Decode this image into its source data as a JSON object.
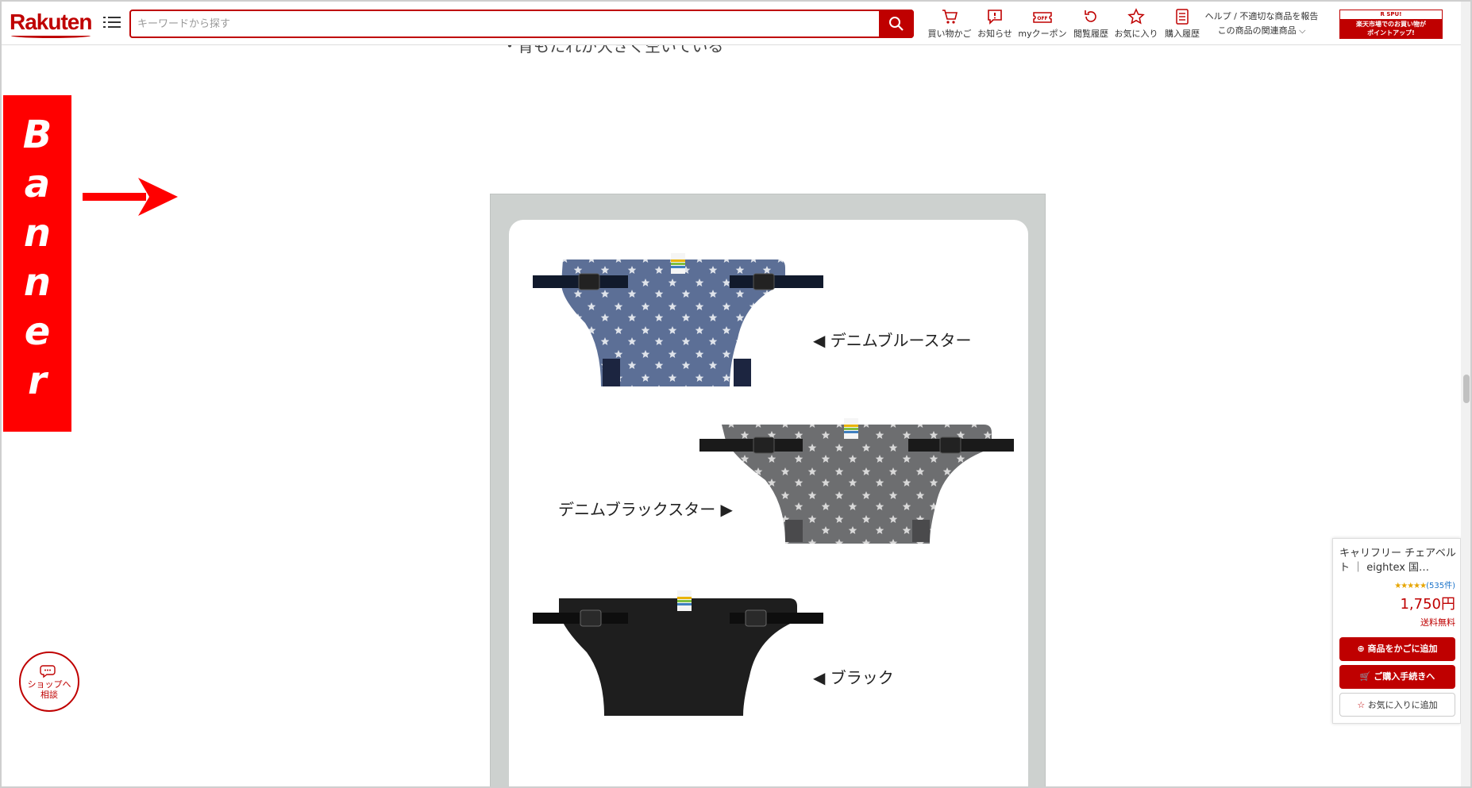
{
  "header": {
    "logo": "Rakuten",
    "search_placeholder": "キーワードから探す",
    "nav": [
      {
        "label": "買い物かご",
        "icon": "cart-icon"
      },
      {
        "label": "お知らせ",
        "icon": "notification-icon"
      },
      {
        "label": "myクーポン",
        "icon": "coupon-icon"
      },
      {
        "label": "閲覧履歴",
        "icon": "history-icon"
      },
      {
        "label": "お気に入り",
        "icon": "star-icon"
      },
      {
        "label": "購入履歴",
        "icon": "list-icon"
      }
    ],
    "help": "ヘルプ / 不適切な商品を報告",
    "related": "この商品の関連商品",
    "spu_top": "R SPU!",
    "spu_line1": "楽天市場でのお買い物が",
    "spu_line2": "ポイントアップ!"
  },
  "banner": {
    "letters": [
      "B",
      "a",
      "n",
      "n",
      "e",
      "r"
    ],
    "color": "#ff0000"
  },
  "content": {
    "cut_text": "・背もたれが大きく空いている",
    "variants": [
      {
        "label": "◀  デニムブルースター"
      },
      {
        "label": "デニムブラックスター  ▶"
      },
      {
        "label": "◀  ブラック"
      }
    ]
  },
  "shop_chat": {
    "line1": "ショップへ",
    "line2": "相談"
  },
  "buybox": {
    "title": "キャリフリー チェアベルト ｜ eightex 国…",
    "rating": 4.5,
    "stars": "★★★★★",
    "review_count": "(535件)",
    "price": "1,750円",
    "shipping": "送料無料",
    "add_to_cart": "商品をかごに追加",
    "checkout": "ご購入手続きへ",
    "favorite": "お気に入りに追加"
  },
  "colors": {
    "brand": "#bf0000",
    "panel_bg": "#cdd1cf"
  }
}
